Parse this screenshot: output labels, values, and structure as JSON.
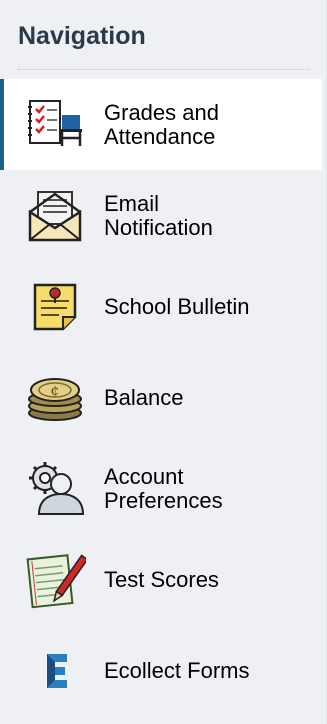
{
  "nav": {
    "title": "Navigation",
    "items": [
      {
        "label": "Grades and\nAttendance",
        "icon": "grades-attendance-icon",
        "active": true
      },
      {
        "label": "Email\nNotification",
        "icon": "envelope-icon",
        "active": false
      },
      {
        "label": "School Bulletin",
        "icon": "bulletin-note-icon",
        "active": false
      },
      {
        "label": "Balance",
        "icon": "coin-stack-icon",
        "active": false
      },
      {
        "label": "Account\nPreferences",
        "icon": "user-gear-icon",
        "active": false
      },
      {
        "label": "Test Scores",
        "icon": "test-paper-icon",
        "active": false
      },
      {
        "label": "Ecollect Forms",
        "icon": "ecollect-logo-icon",
        "active": false
      }
    ]
  },
  "colors": {
    "sidebar_bg": "#eef0f3",
    "active_bg": "#ffffff",
    "active_indicator": "#1f5f8b",
    "title_text": "#2a3a4a"
  }
}
